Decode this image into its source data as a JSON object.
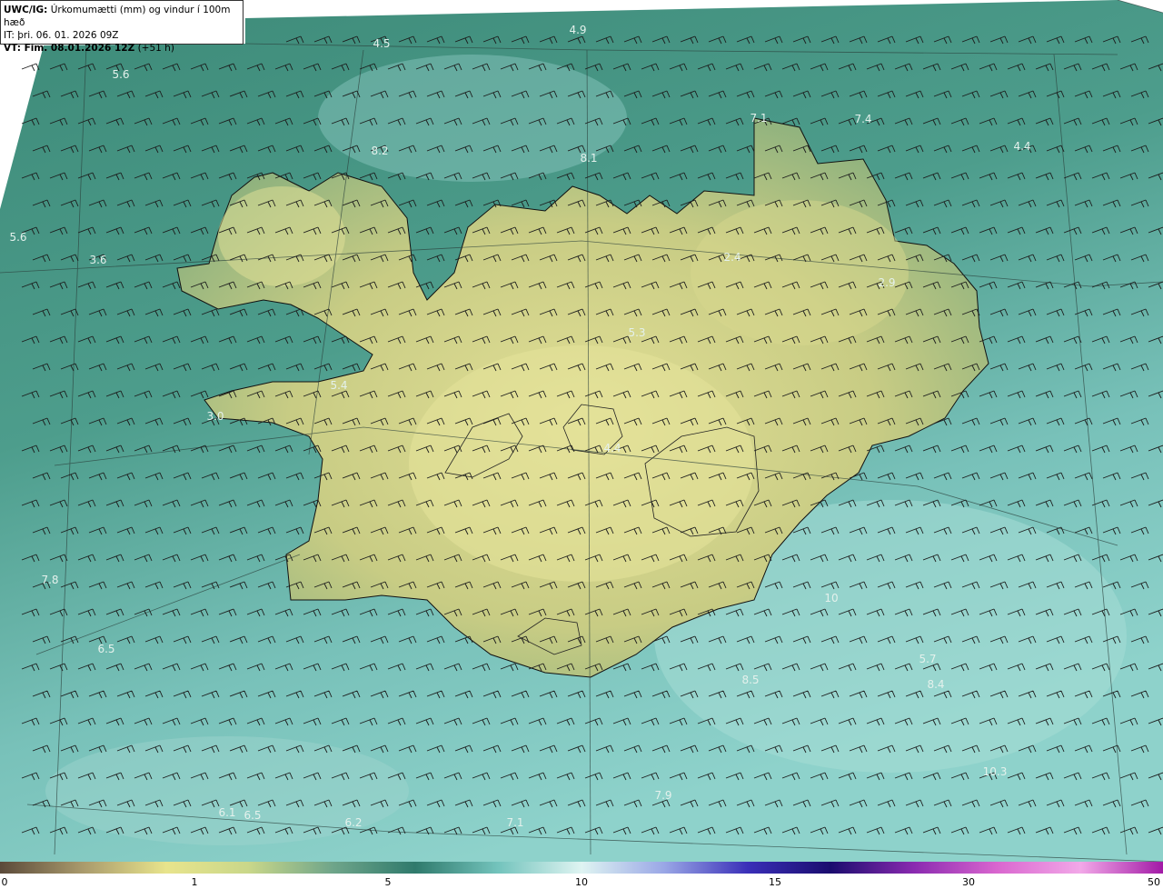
{
  "header": {
    "model": "UWC/IG:",
    "title": "Úrkomumætti (mm) og vindur í 100m hæð",
    "it_line": "IT: þri. 06. 01. 2026 09Z",
    "vt_prefix": "VT: Fim. 08.01.2026 12Z",
    "vt_suffix": "(+51 h)"
  },
  "point_values": [
    {
      "text": "4.5"
    },
    {
      "text": "4.9"
    },
    {
      "text": "5.6"
    },
    {
      "text": "7.1"
    },
    {
      "text": "7.4"
    },
    {
      "text": "4.4"
    },
    {
      "text": "5.6"
    },
    {
      "text": "3.6"
    },
    {
      "text": "2.4"
    },
    {
      "text": "2.9"
    },
    {
      "text": "5.3"
    },
    {
      "text": "5.4"
    },
    {
      "text": "3.0"
    },
    {
      "text": "4.4"
    },
    {
      "text": "7.8"
    },
    {
      "text": "6.5"
    },
    {
      "text": "5.7"
    },
    {
      "text": "10.3"
    },
    {
      "text": "7.9"
    },
    {
      "text": "6.1"
    },
    {
      "text": "6.2"
    },
    {
      "text": "7.1"
    },
    {
      "text": "8.5"
    },
    {
      "text": "10"
    },
    {
      "text": "8.2"
    },
    {
      "text": "8.1"
    },
    {
      "text": "6.5"
    },
    {
      "text": "8.4"
    }
  ],
  "colorbar": {
    "ticks": [
      "0",
      "1",
      "5",
      "10",
      "15",
      "30",
      "50"
    ],
    "colors": [
      "#5b4a3a",
      "#a99a6c",
      "#e8e48c",
      "#c9d78a",
      "#6fa58a",
      "#2f7a6c",
      "#74c4bd",
      "#dff4f2",
      "#9aa7e6",
      "#3a2fb8",
      "#1a0c6e",
      "#8a2ab0",
      "#d966cf",
      "#f2a8e8",
      "#a21aa6"
    ]
  },
  "map_colors": {
    "sea_dark": "#3e8c7a",
    "sea_light": "#7fc8c0",
    "land_low": "#c2c97f",
    "land_high": "#e6e39a",
    "coast": "#111111"
  }
}
